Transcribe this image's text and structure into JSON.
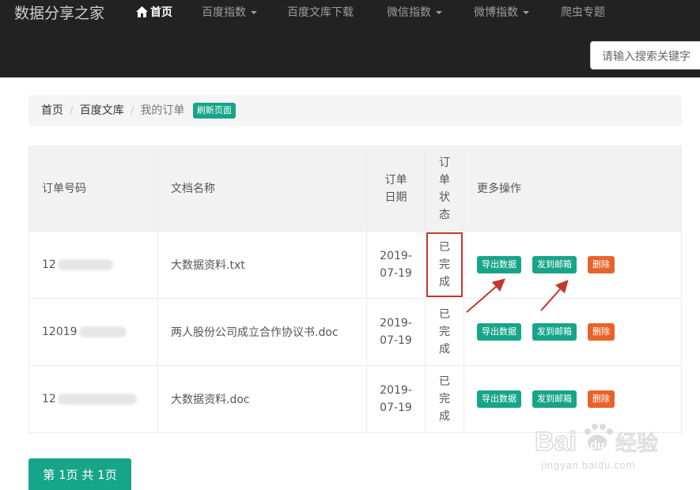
{
  "navbar": {
    "brand": "数据分享之家",
    "items": [
      {
        "label": "首页",
        "active": true,
        "caret": false
      },
      {
        "label": "百度指数",
        "active": false,
        "caret": true
      },
      {
        "label": "百度文库下载",
        "active": false,
        "caret": false
      },
      {
        "label": "微信指数",
        "active": false,
        "caret": true
      },
      {
        "label": "微博指数",
        "active": false,
        "caret": true
      },
      {
        "label": "爬虫专题",
        "active": false,
        "caret": false
      }
    ],
    "search_placeholder": "请输入搜索关键字"
  },
  "breadcrumb": {
    "items": [
      "首页",
      "百度文库"
    ],
    "current": "我的订单",
    "refresh_label": "刷新页面"
  },
  "table": {
    "headers": [
      "订单号码",
      "文档名称",
      "订单日期",
      "订单状态",
      "更多操作"
    ],
    "rows": [
      {
        "order_id": "12",
        "doc_name": "大数据资料.txt",
        "date": "2019-07-19",
        "status": "已完成"
      },
      {
        "order_id": "12019",
        "doc_name": "两人股份公司成立合作协议书.doc",
        "date": "2019-07-19",
        "status": "已完成"
      },
      {
        "order_id": "12",
        "doc_name": "大数据资料.doc",
        "date": "2019-07-19",
        "status": "已完成"
      }
    ],
    "actions": {
      "export": "导出数据",
      "email": "发到邮箱",
      "delete": "删除"
    }
  },
  "pager": {
    "label": "第 1页 共 1页"
  },
  "watermark": {
    "sub": "jingyan.baidu.com"
  },
  "colors": {
    "navbar": "#222222",
    "accent": "#17a589",
    "danger": "#e8632b",
    "highlight": "#c0392b"
  }
}
